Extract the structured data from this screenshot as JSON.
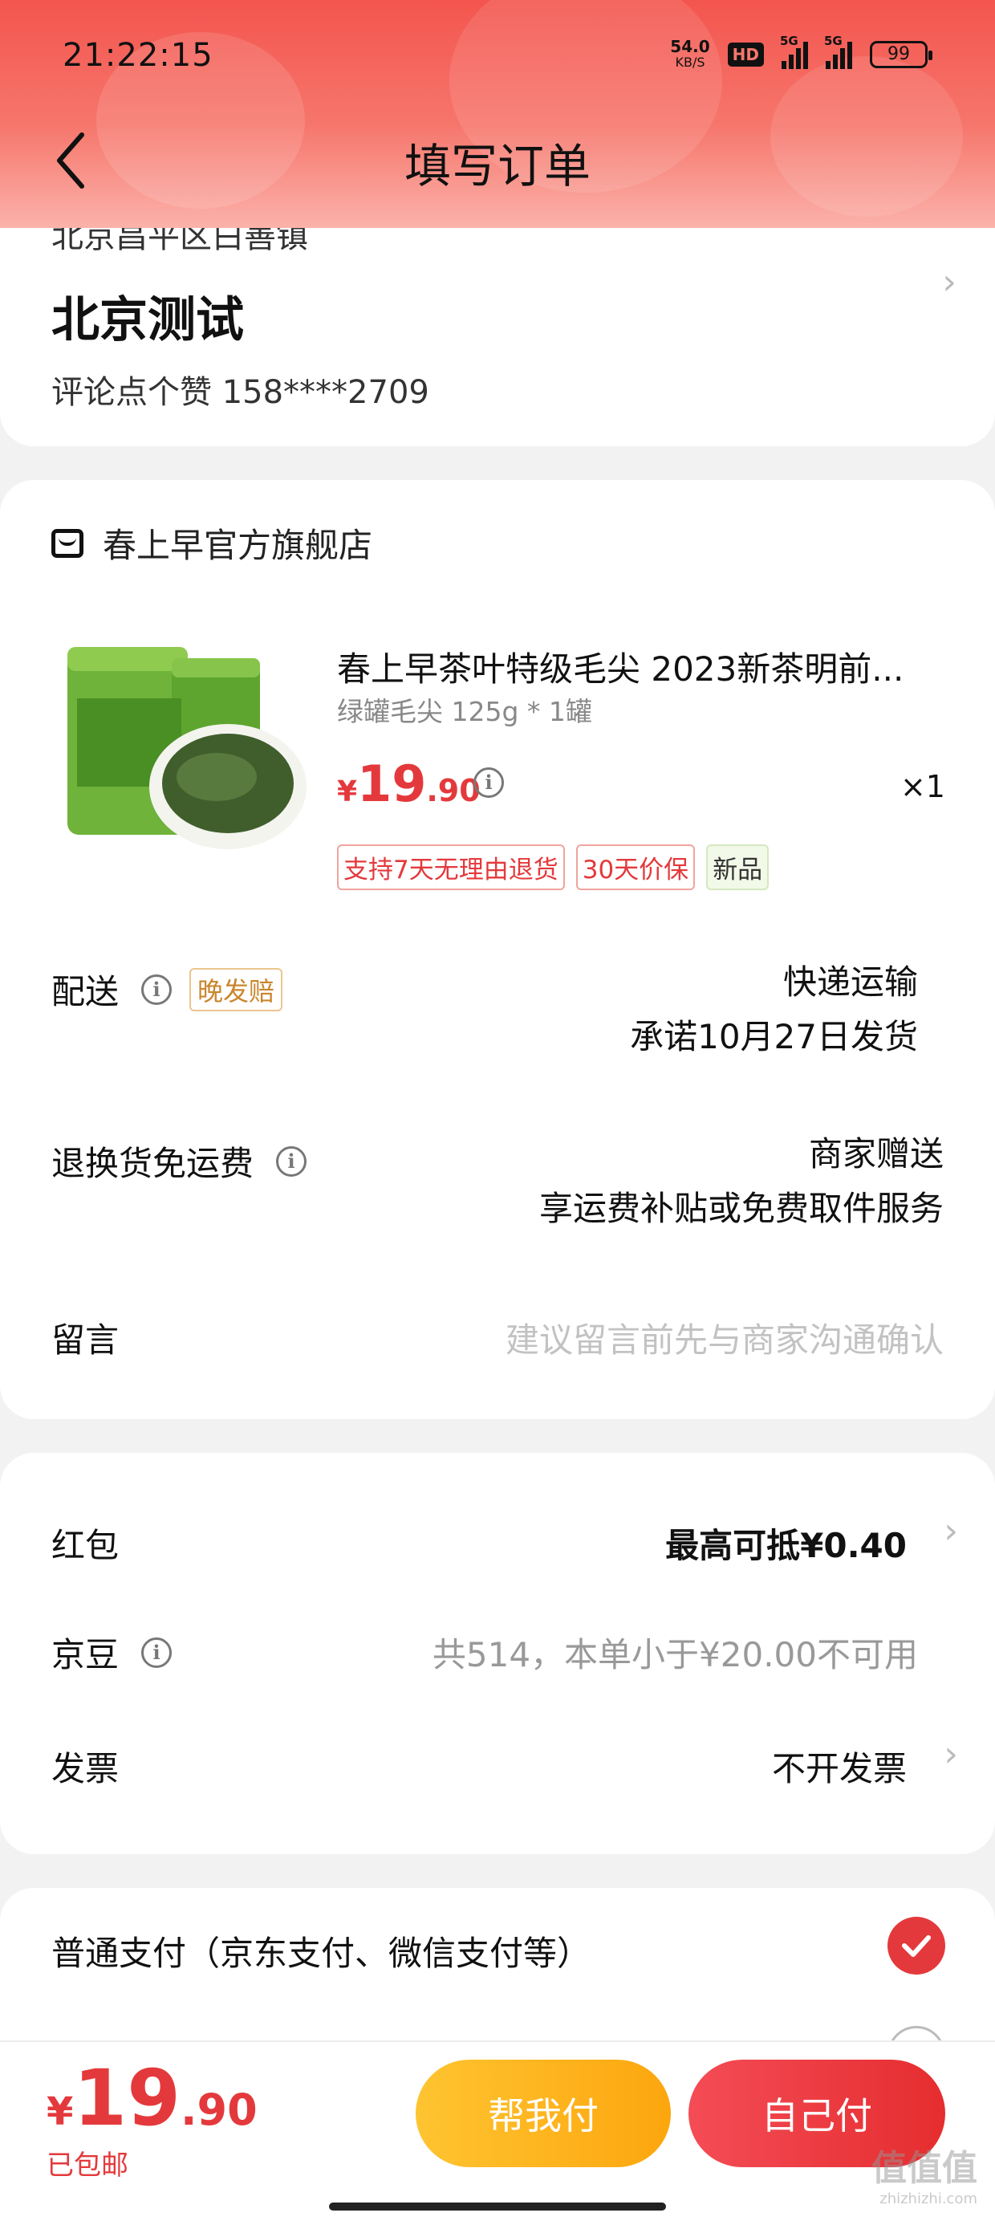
{
  "status_bar": {
    "time": "21:22:15",
    "net_speed": "54.0",
    "net_unit": "KB/S",
    "hd": "HD",
    "sim1": "5G",
    "sim2": "5G",
    "battery": "99"
  },
  "header": {
    "title": "填写订单"
  },
  "address": {
    "line": "北京昌平区白善镇",
    "name": "北京测试",
    "contact": "评论点个赞  158****2709"
  },
  "shop": {
    "name": "春上早官方旗舰店"
  },
  "product": {
    "title": "春上早茶叶特级毛尖 2023新茶明前...",
    "spec": "绿罐毛尖 125g * 1罐",
    "price_symbol": "¥",
    "price_int": "19",
    "price_dec": ".90",
    "quantity": "×1",
    "tags": [
      "支持7天无理由退货",
      "30天价保",
      "新品"
    ]
  },
  "delivery": {
    "label": "配送",
    "badge": "晚发赔",
    "method": "快递运输",
    "promise": "承诺10月27日发货"
  },
  "return_shipping": {
    "label": "退换货免运费",
    "value": "商家赠送",
    "desc": "享运费补贴或免费取件服务"
  },
  "message": {
    "label": "留言",
    "placeholder": "建议留言前先与商家沟通确认"
  },
  "discounts": {
    "red_packet_label": "红包",
    "red_packet_value": "最高可抵¥0.40",
    "jd_beans_label": "京豆",
    "jd_beans_value": "共514，本单小于¥20.00不可用",
    "invoice_label": "发票",
    "invoice_value": "不开发票"
  },
  "payment": {
    "normal_label": "普通支付（京东支付、微信支付等）"
  },
  "bottom": {
    "total_symbol": "¥",
    "total_int": "19",
    "total_dec": ".90",
    "free_shipping": "已包邮",
    "help_pay": "帮我付",
    "self_pay": "自己付"
  },
  "watermark": {
    "text": "值值值",
    "sub": "zhizhizhi.com"
  },
  "colors": {
    "accent": "#e4393c",
    "help_button": "#fdb822",
    "header": "#f3554e"
  }
}
